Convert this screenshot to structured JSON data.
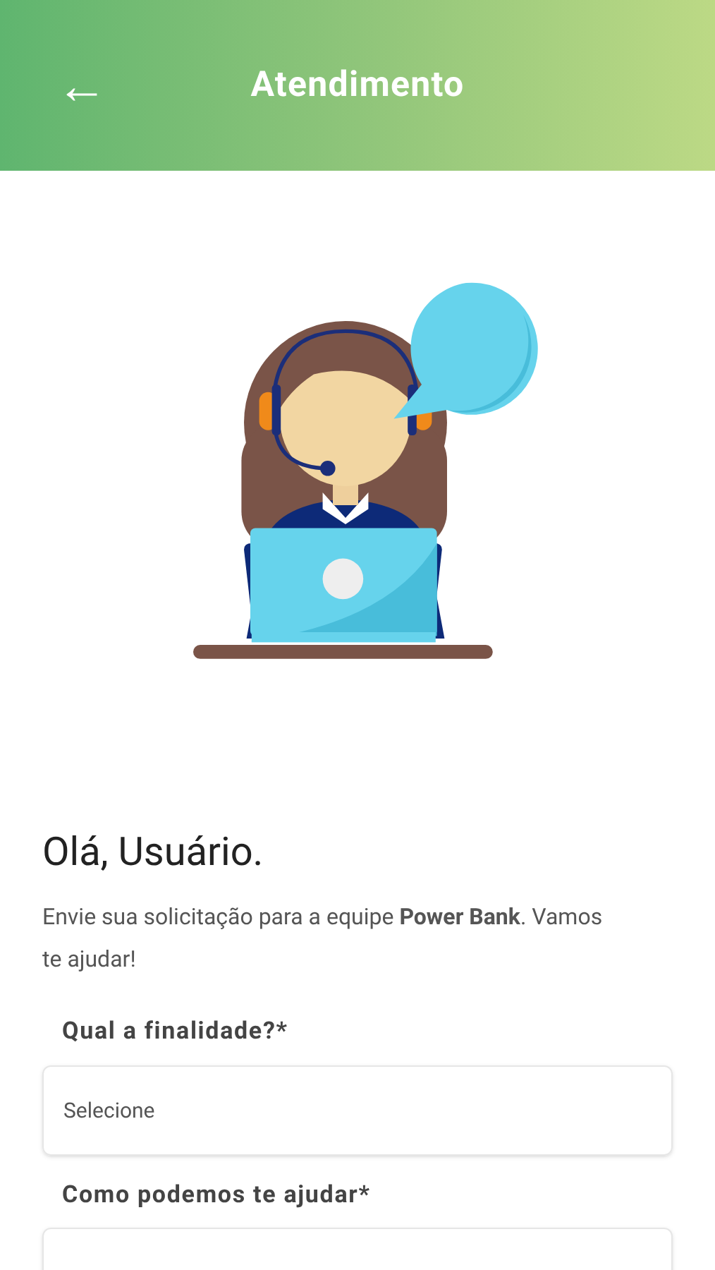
{
  "header": {
    "back_icon": "←",
    "title": "Atendimento"
  },
  "greeting": "Olá, Usuário.",
  "intro": "Envie sua solicitação para a equipe **Power Bank**. Vamos te ajudar!",
  "fields": [
    {
      "label": "Qual a finalidade?*",
      "placeholder": "Selecione"
    },
    {
      "label": "Como podemos te ajudar*"
    }
  ]
}
